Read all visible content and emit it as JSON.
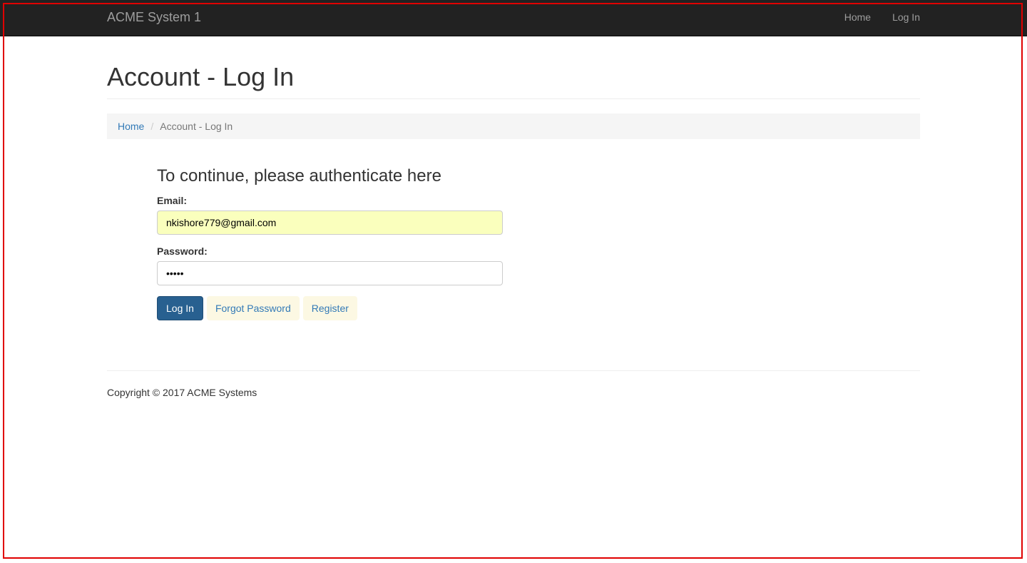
{
  "navbar": {
    "brand": "ACME System 1",
    "links": [
      "Home",
      "Log In"
    ]
  },
  "page": {
    "title": "Account - Log In"
  },
  "breadcrumb": {
    "home": "Home",
    "separator": "/",
    "current": "Account - Log In"
  },
  "form": {
    "heading": "To continue, please authenticate here",
    "email_label": "Email:",
    "email_value": "nkishore779@gmail.com",
    "password_label": "Password:",
    "password_value": "•••••",
    "login_button": "Log In",
    "forgot_button": "Forgot Password",
    "register_button": "Register"
  },
  "footer": {
    "copyright": "Copyright © 2017 ACME Systems"
  },
  "colors": {
    "navbar_bg": "#222222",
    "primary": "#286090",
    "link": "#337ab7",
    "autofill": "#faffbd",
    "frame": "#e00000"
  }
}
